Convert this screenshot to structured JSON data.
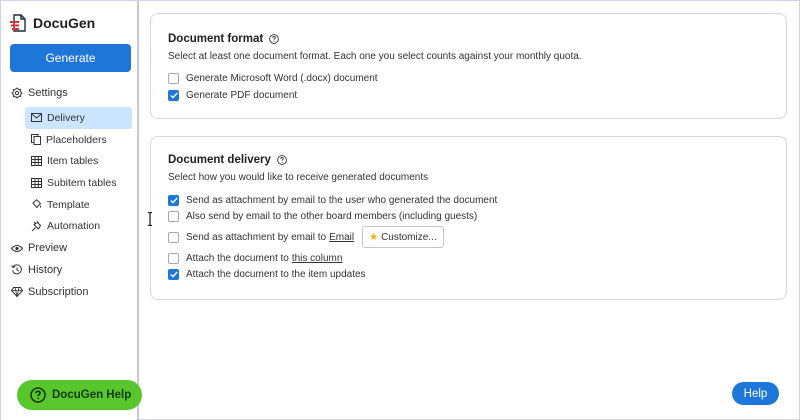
{
  "brand": {
    "name": "DocuGen"
  },
  "sidebar": {
    "generate_label": "Generate",
    "settings_label": "Settings",
    "sub_items": [
      {
        "label": "Delivery",
        "icon": "mail-icon",
        "active": true
      },
      {
        "label": "Placeholders",
        "icon": "copy-icon",
        "active": false
      },
      {
        "label": "Item tables",
        "icon": "table-icon",
        "active": false
      },
      {
        "label": "Subitem tables",
        "icon": "table-icon",
        "active": false
      },
      {
        "label": "Template",
        "icon": "paint-bucket-icon",
        "active": false
      },
      {
        "label": "Automation",
        "icon": "plug-icon",
        "active": false
      }
    ],
    "nav_items": [
      {
        "label": "Preview",
        "icon": "eye-icon"
      },
      {
        "label": "History",
        "icon": "history-icon"
      },
      {
        "label": "Subscription",
        "icon": "diamond-icon"
      }
    ],
    "help_label": "DocuGen Help"
  },
  "document_format": {
    "title": "Document format",
    "description": "Select at least one document format. Each one you select counts against your monthly quota.",
    "options": [
      {
        "label": "Generate Microsoft Word (.docx) document",
        "checked": false
      },
      {
        "label": "Generate PDF document",
        "checked": true
      }
    ]
  },
  "document_delivery": {
    "title": "Document delivery",
    "description": "Select how you would like to receive generated documents",
    "options": [
      {
        "label": "Send as attachment by email to the user who generated the document",
        "checked": true
      },
      {
        "label": "Also send by email to the other board members (including guests)",
        "checked": false
      },
      {
        "label": "Send as attachment by email to",
        "link": "Email",
        "button": "Customize...",
        "checked": false
      },
      {
        "label": "Attach the document to",
        "link": "this column",
        "checked": false
      },
      {
        "label": "Attach the document to the item updates",
        "checked": true
      }
    ]
  },
  "help_button_label": "Help",
  "colors": {
    "primary": "#1f76d9",
    "active_bg": "#cce5ff",
    "help_green": "#5ac62e",
    "brand_red": "#e0312e"
  }
}
